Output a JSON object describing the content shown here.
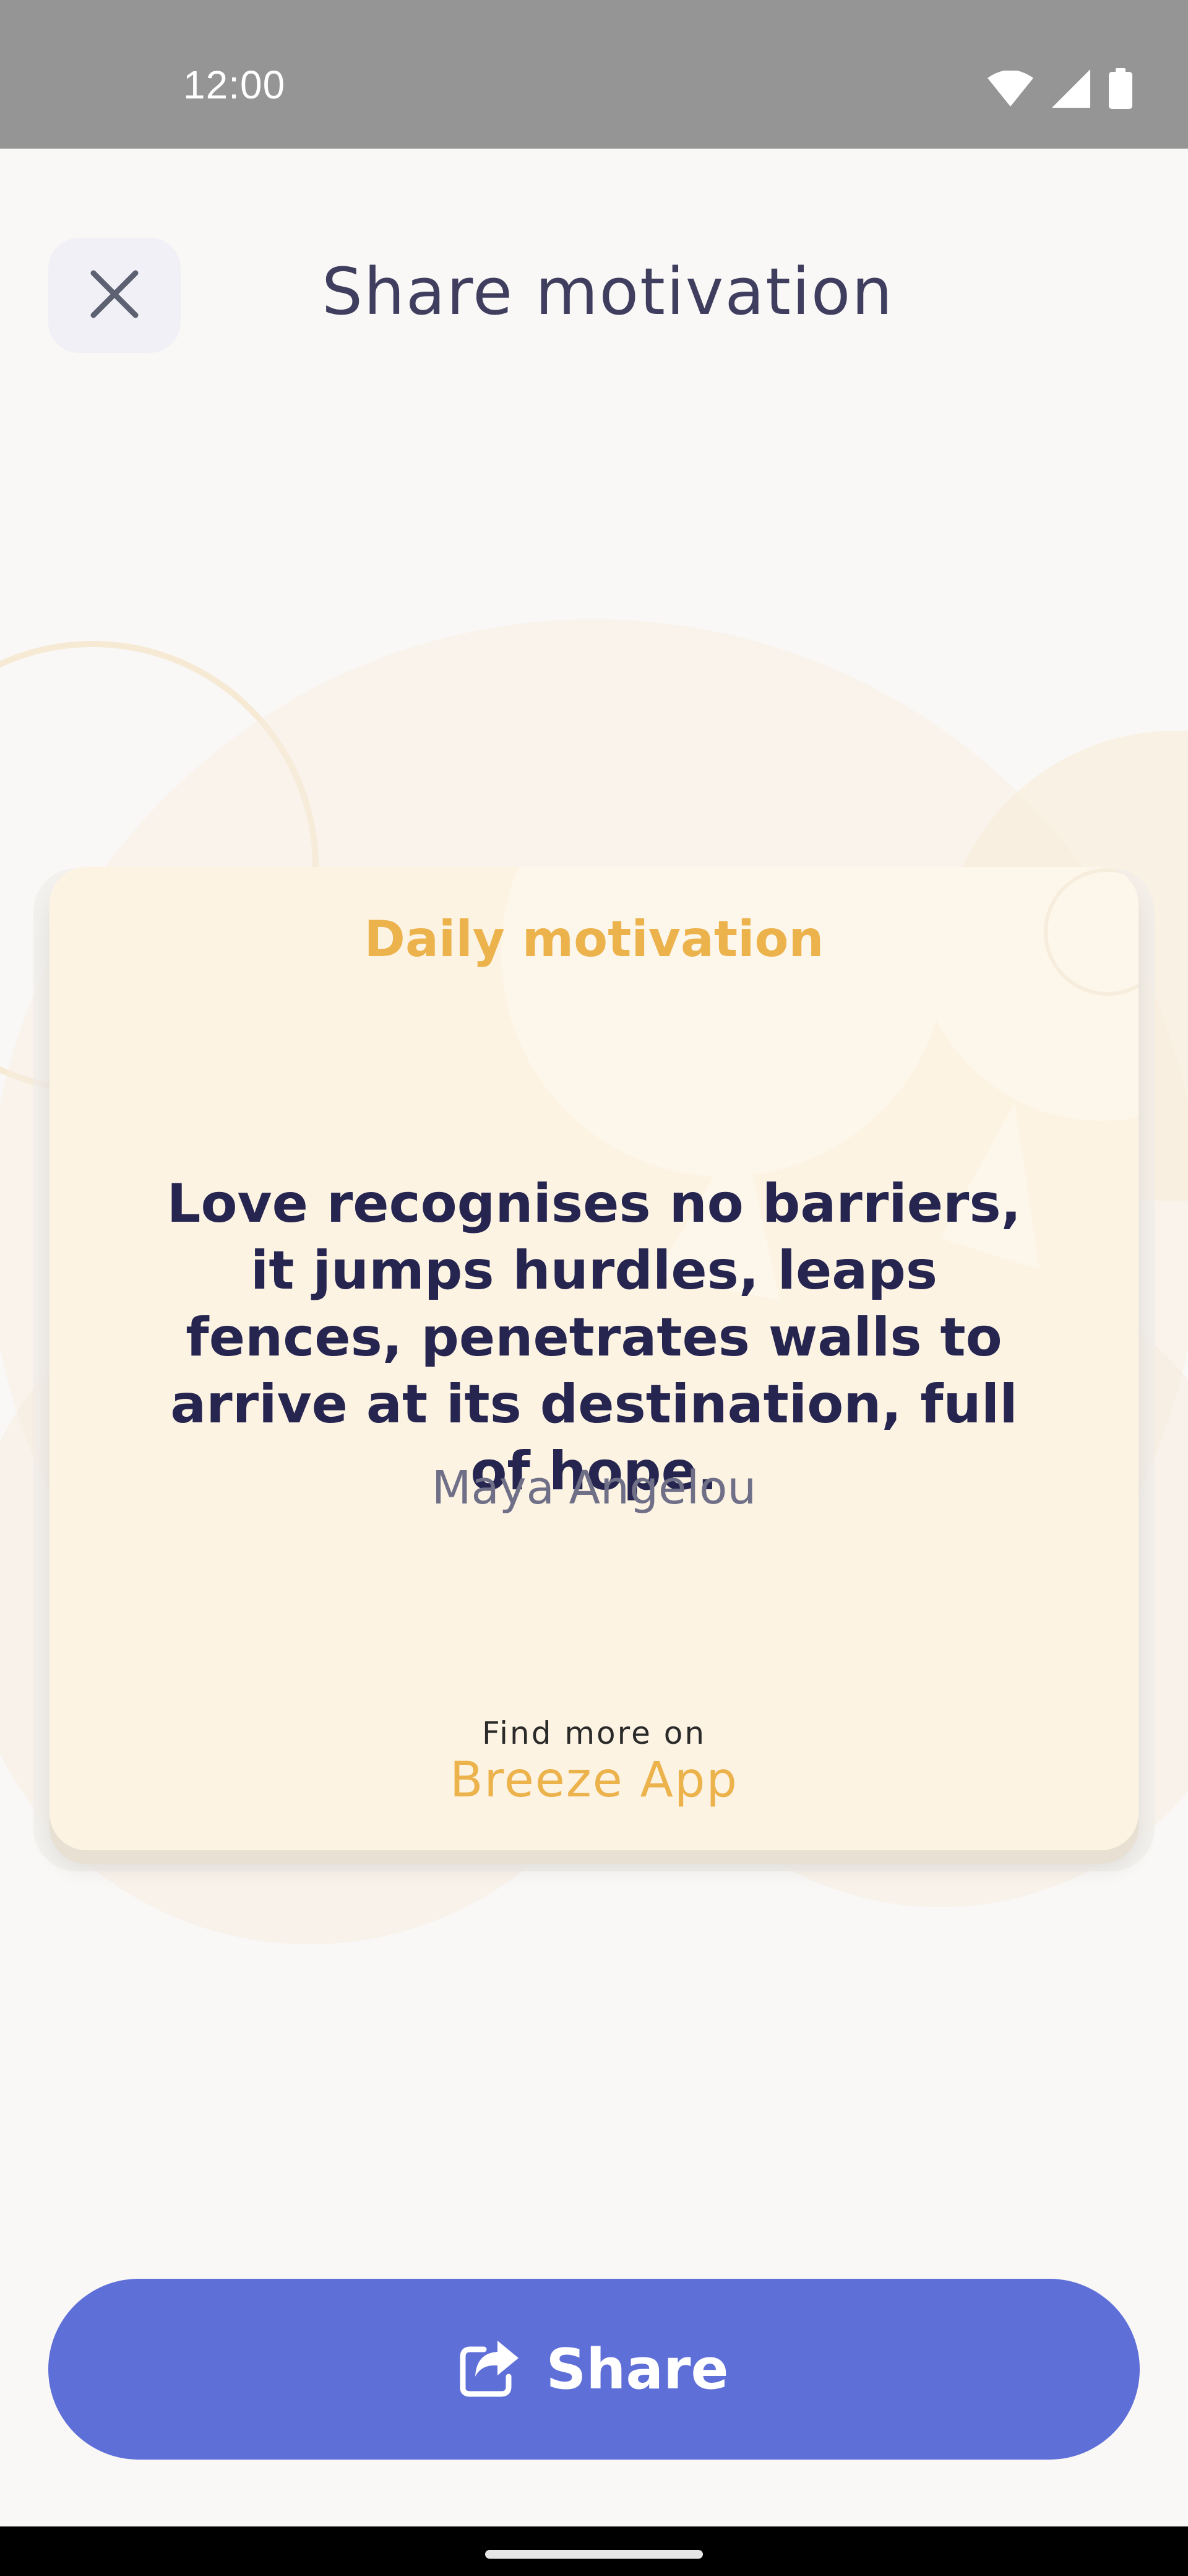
{
  "status_bar": {
    "time": "12:00",
    "icons": [
      "wifi-icon",
      "signal-icon",
      "battery-icon"
    ]
  },
  "header": {
    "close_icon": "close-icon",
    "title": "Share motivation"
  },
  "card": {
    "heading": "Daily motivation",
    "quote": "Love recognises no barriers, it jumps hurdles, leaps fences, penetrates walls to arrive at its destination, full of hope.",
    "author": "Maya Angelou",
    "footer_prefix": "Find more on",
    "footer_brand": "Breeze App"
  },
  "share_button": {
    "label": "Share",
    "icon": "share-icon"
  },
  "colors": {
    "accent": "#5f6fd8",
    "brand": "#ecb24b",
    "title": "#3f3e5e",
    "quote": "#252550",
    "card_background": "#fdf3e3"
  }
}
